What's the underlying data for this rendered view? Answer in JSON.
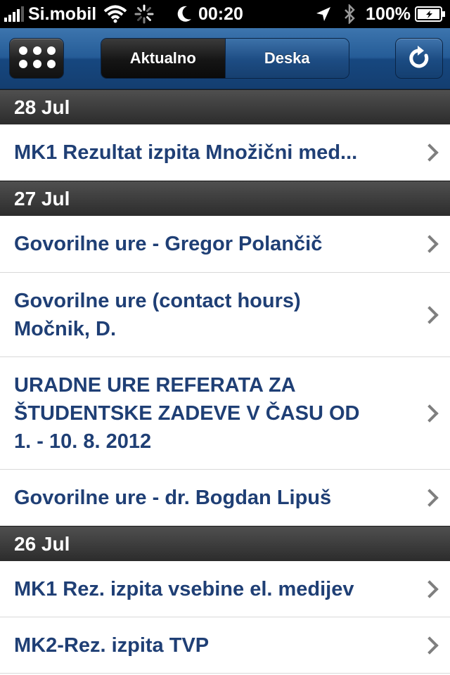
{
  "status_bar": {
    "carrier": "Si.mobil",
    "time": "00:20",
    "battery": "100%",
    "icons": [
      "signal-icon",
      "wifi-icon",
      "activity-spinner-icon",
      "moon-icon",
      "location-icon",
      "bluetooth-icon",
      "battery-icon"
    ]
  },
  "nav": {
    "segments": [
      "Aktualno",
      "Deska"
    ],
    "selected": "Aktualno"
  },
  "sections": [
    {
      "date": "28 Jul",
      "items": [
        "MK1  Rezultat izpita Množični med..."
      ]
    },
    {
      "date": "27 Jul",
      "items": [
        "Govorilne ure - Gregor Polančič",
        "Govorilne ure (contact hours)\nMočnik, D.",
        "URADNE URE REFERATA ZA\nŠTUDENTSKE ZADEVE V ČASU OD\n1. - 10. 8. 2012",
        "Govorilne ure - dr. Bogdan Lipuš"
      ]
    },
    {
      "date": "26 Jul",
      "items": [
        "MK1 Rez. izpita vsebine el. medijev",
        "MK2-Rez. izpita TVP"
      ]
    }
  ],
  "colors": {
    "nav_blue": "#1f4f87",
    "item_text": "#1f3f75",
    "section_bg": "#3a3a3a"
  }
}
